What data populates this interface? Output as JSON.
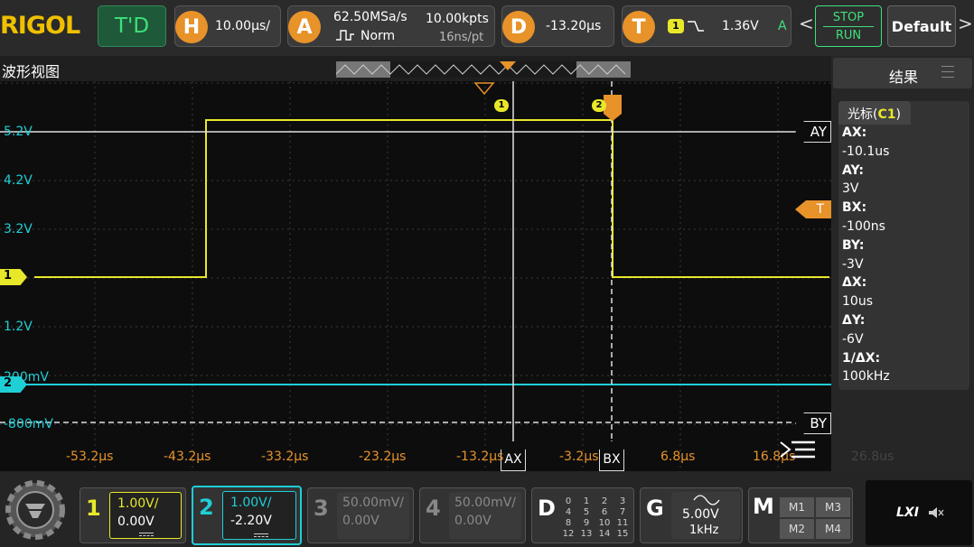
{
  "brand": "RIGOL",
  "top": {
    "mode_label": "T'D",
    "horizontal": {
      "letter": "H",
      "value": "10.00μs/"
    },
    "acquire": {
      "letter": "A",
      "rate": "62.50MSa/s",
      "mode": "Norm",
      "mem": "10.00kpts",
      "sample": "16ns/pt"
    },
    "delay": {
      "letter": "D",
      "value": "-13.20μs"
    },
    "trigger": {
      "letter": "T",
      "source": "1",
      "level": "1.36V",
      "status": "A"
    },
    "stop_label": "STOP",
    "run_label": "RUN",
    "default_label": "Default"
  },
  "wave": {
    "title": "波形视图",
    "y_labels": [
      "5.2V",
      "4.2V",
      "3.2V",
      "1.2V",
      "200mV",
      "-800mV"
    ],
    "x_labels": [
      "-53.2μs",
      "-43.2μs",
      "-33.2μs",
      "-23.2μs",
      "-13.2μs",
      "-3.2μs",
      "6.8μs",
      "16.8μs"
    ],
    "ch1_marker": "1",
    "ch2_marker": "2",
    "ay_label": "AY",
    "by_label": "BY",
    "ax_label": "AX",
    "bx_label": "BX",
    "t_label": "T",
    "c1_marker": "1",
    "c2_marker": "2",
    "faded_time": "26.8us",
    "colors": {
      "ch1": "#e8e82a",
      "ch2": "#1ecfd6",
      "accent": "#e8922a"
    }
  },
  "panel": {
    "title": "结果",
    "tab_prefix": "光标(",
    "tab_channel": "C1",
    "tab_suffix": ")",
    "rows": [
      {
        "k": "AX:",
        "v": "-10.1us"
      },
      {
        "k": "AY:",
        "v": "3V"
      },
      {
        "k": "BX:",
        "v": "-100ns"
      },
      {
        "k": "BY:",
        "v": "-3V"
      },
      {
        "k": "ΔX:",
        "v": "10us"
      },
      {
        "k": "ΔY:",
        "v": "-6V"
      },
      {
        "k": "1/ΔX:",
        "v": "100kHz"
      }
    ]
  },
  "bottom": {
    "ch1": {
      "num": "1",
      "scale": "1.00V/",
      "offset": "0.00V"
    },
    "ch2": {
      "num": "2",
      "scale": "1.00V/",
      "offset": "-2.20V"
    },
    "ch3": {
      "num": "3",
      "scale": "50.00mV/",
      "offset": "0.00V"
    },
    "ch4": {
      "num": "4",
      "scale": "50.00mV/",
      "offset": "0.00V"
    },
    "digital": {
      "letter": "D",
      "grid": [
        "0",
        "1",
        "2",
        "3",
        "4",
        "5",
        "6",
        "7",
        "8",
        "9",
        "10",
        "11",
        "12",
        "13",
        "14",
        "15"
      ]
    },
    "gen": {
      "letter": "G",
      "amp": "5.00V",
      "freq": "1kHz"
    },
    "math": {
      "letter": "M",
      "items": [
        "M1",
        "M3",
        "M2",
        "M4"
      ]
    },
    "lxi": "LXI"
  }
}
